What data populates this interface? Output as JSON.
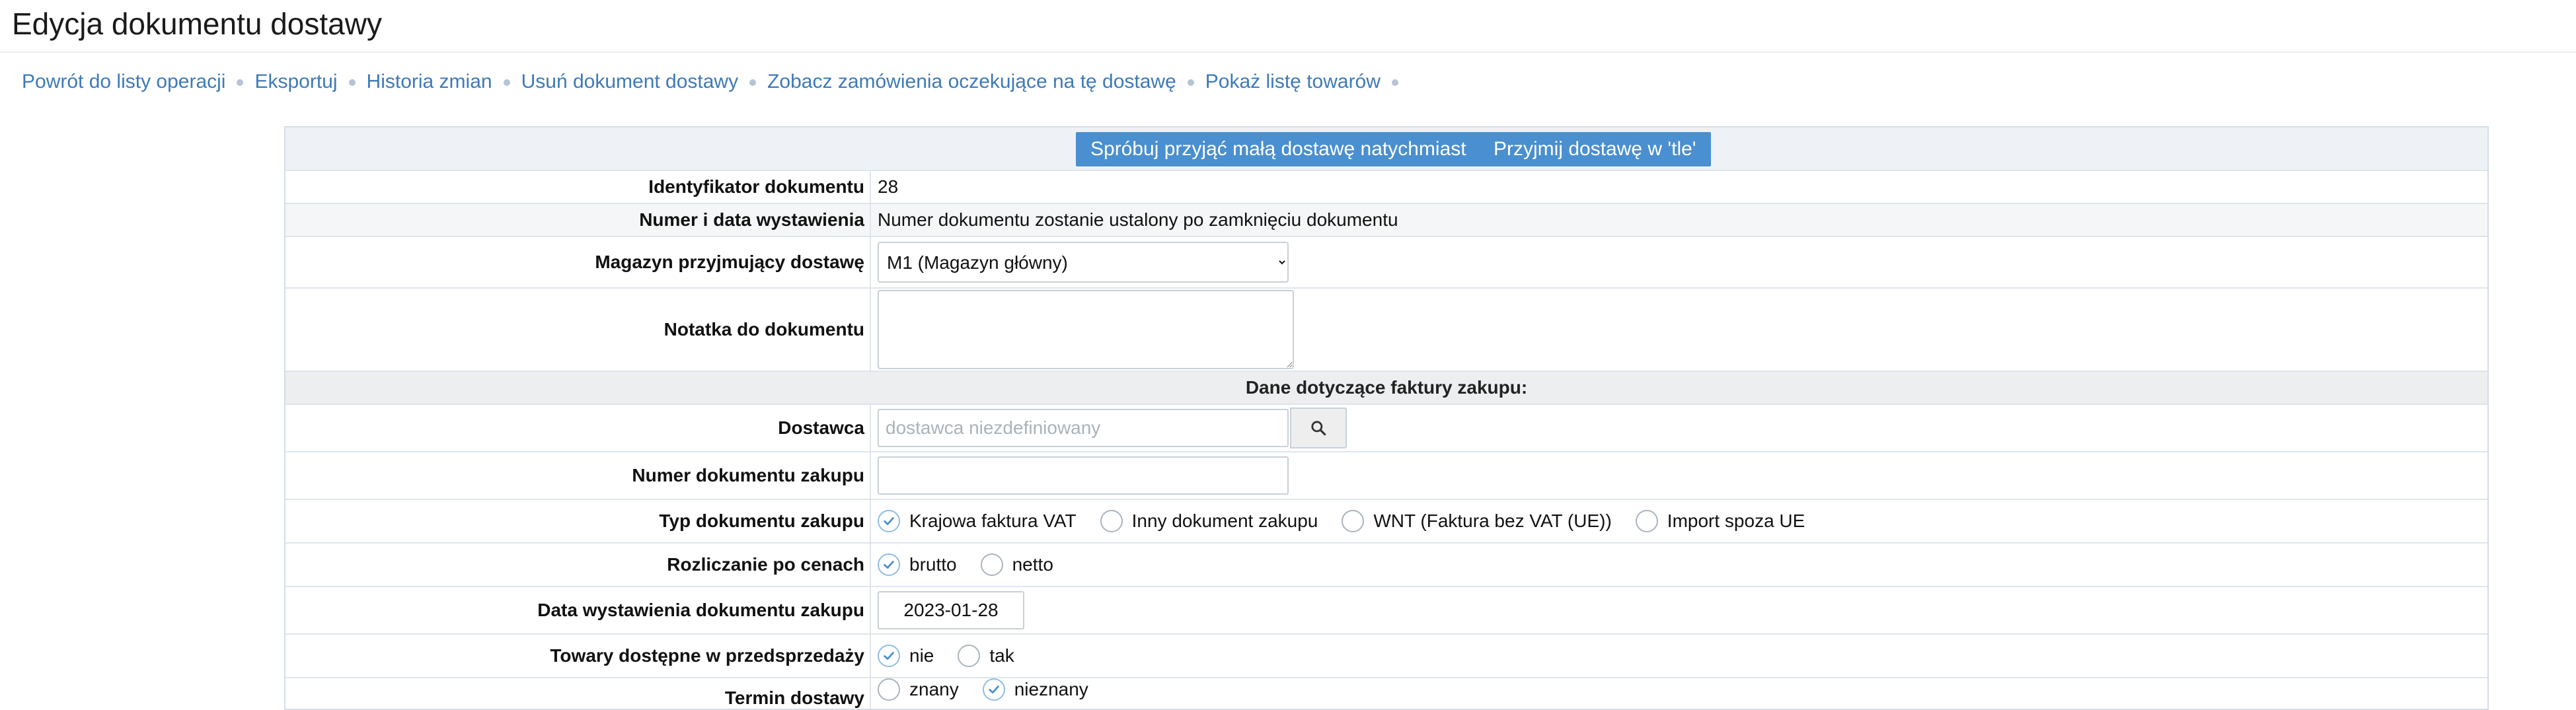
{
  "title": "Edycja dokumentu dostawy",
  "nav": [
    "Powrót do listy operacji",
    "Eksportuj",
    "Historia zmian",
    "Usuń dokument dostawy",
    "Zobacz zamówienia oczekujące na tę dostawę",
    "Pokaż listę towarów"
  ],
  "buttons": {
    "accept_now": "Spróbuj przyjąć małą dostawę natychmiast",
    "accept_bg": "Przyjmij dostawę w 'tle'"
  },
  "fields": {
    "doc_id": {
      "label": "Identyfikator dokumentu",
      "value": "28"
    },
    "number_date": {
      "label": "Numer i data wystawienia",
      "value": "Numer dokumentu zostanie ustalony po zamknięciu dokumentu"
    },
    "warehouse": {
      "label": "Magazyn przyjmujący dostawę",
      "value": "M1 (Magazyn główny)"
    },
    "note": {
      "label": "Notatka do dokumentu",
      "value": ""
    },
    "invoice_section": "Dane dotyczące faktury zakupu:",
    "supplier": {
      "label": "Dostawca",
      "placeholder": "dostawca niezdefiniowany",
      "value": ""
    },
    "purchase_number": {
      "label": "Numer dokumentu zakupu",
      "value": ""
    },
    "purchase_type": {
      "label": "Typ dokumentu zakupu",
      "options": [
        "Krajowa faktura VAT",
        "Inny dokument zakupu",
        "WNT (Faktura bez VAT (UE))",
        "Import spoza UE"
      ],
      "selected": "Krajowa faktura VAT"
    },
    "pricing": {
      "label": "Rozliczanie po cenach",
      "options": [
        "brutto",
        "netto"
      ],
      "selected": "brutto"
    },
    "issue_date": {
      "label": "Data wystawienia dokumentu zakupu",
      "value": "2023-01-28"
    },
    "presale": {
      "label": "Towary dostępne w przedsprzedaży",
      "options": [
        "nie",
        "tak"
      ],
      "selected": "nie"
    },
    "delivery_term": {
      "label": "Termin dostawy",
      "options": [
        "znany",
        "nieznany"
      ],
      "selected": "nieznany"
    }
  },
  "colors": {
    "accent": "#4a8fcf",
    "link": "#3d7ab8",
    "check": "#4a8fcf"
  },
  "icons": {
    "search": "search-icon",
    "radio_checked": "check-icon"
  }
}
